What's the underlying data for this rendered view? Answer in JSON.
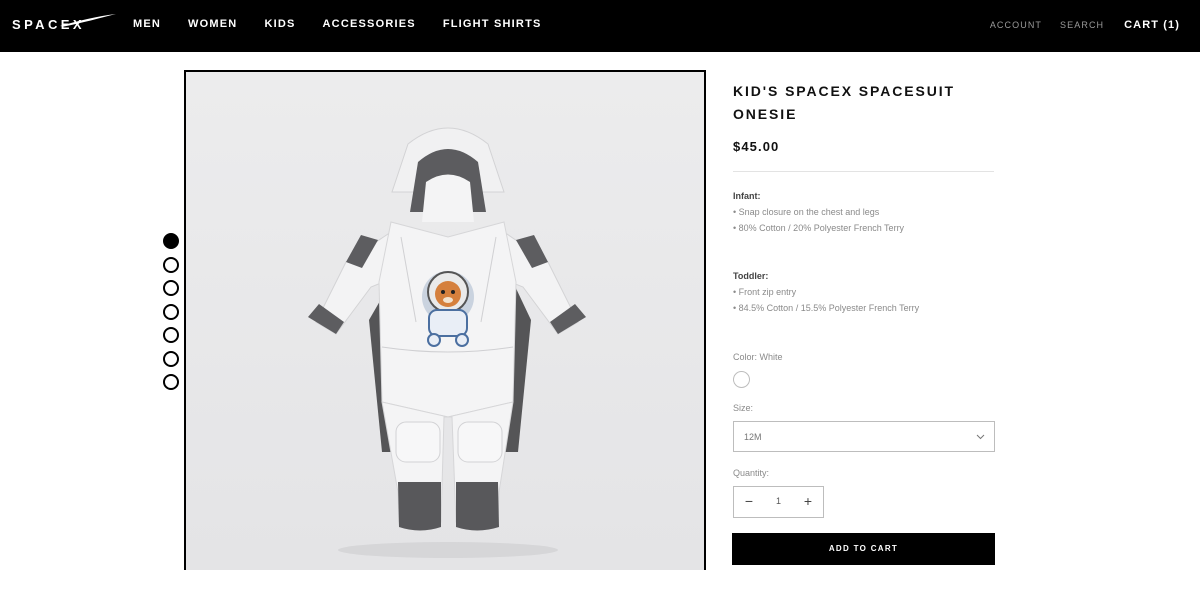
{
  "brand": {
    "logo": "SPACEX"
  },
  "nav": {
    "items": [
      "MEN",
      "WOMEN",
      "KIDS",
      "ACCESSORIES",
      "FLIGHT SHIRTS"
    ],
    "account": "ACCOUNT",
    "search": "SEARCH",
    "cart": "CART (1)"
  },
  "gallery": {
    "image_count": 7,
    "active_index": 0
  },
  "product": {
    "title": "KID'S SPACEX SPACESUIT ONESIE",
    "price": "$45.00",
    "sections": [
      {
        "label": "Infant:",
        "lines": [
          "• Snap closure on the chest and legs",
          "• 80% Cotton / 20% Polyester French Terry"
        ]
      },
      {
        "label": "Toddler:",
        "lines": [
          "• Front zip entry",
          "• 84.5% Cotton / 15.5% Polyester French Terry"
        ]
      }
    ],
    "color_label": "Color: White",
    "size_label": "Size:",
    "size_value": "12M",
    "quantity_label": "Quantity:",
    "quantity": "1",
    "add_to_cart": "ADD TO CART"
  },
  "icons": {
    "logo": "spacex-logo",
    "select": "chevron-down-icon",
    "minus": "minus-icon",
    "plus": "plus-icon"
  },
  "colors": {
    "header_bg": "#000000",
    "button_bg": "#000000",
    "swatch": "#ffffff"
  }
}
